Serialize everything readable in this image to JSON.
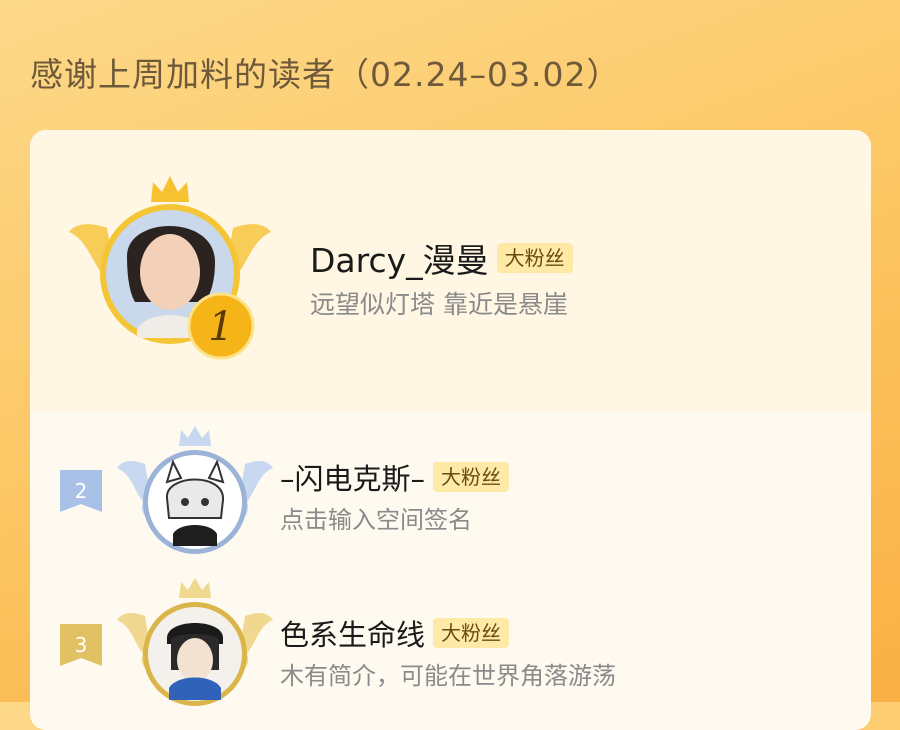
{
  "header": {
    "title": "感谢上周加料的读者（02.24–03.02）"
  },
  "readers": [
    {
      "rank": "1",
      "name": "Darcy_漫曼",
      "badge": "大粉丝",
      "signature": "远望似灯塔 靠近是悬崖"
    },
    {
      "rank": "2",
      "name": "–闪电克斯–",
      "badge": "大粉丝",
      "signature": "点击输入空间签名"
    },
    {
      "rank": "3",
      "name": "色系生命线",
      "badge": "大粉丝",
      "signature": "木有简介，可能在世界角落游荡"
    }
  ],
  "colors": {
    "gold": "#f4b21c",
    "silver": "#a9c1e6",
    "bronze": "#e2c064",
    "badge_bg": "#ffe9a6"
  },
  "icons": {
    "first": [
      "crown-icon",
      "wings-icon",
      "rank-1-medal-icon"
    ],
    "second": [
      "rank-2-flag-icon",
      "wings-icon",
      "crown-icon"
    ],
    "third": [
      "rank-3-flag-icon",
      "wings-icon",
      "crown-icon"
    ]
  }
}
